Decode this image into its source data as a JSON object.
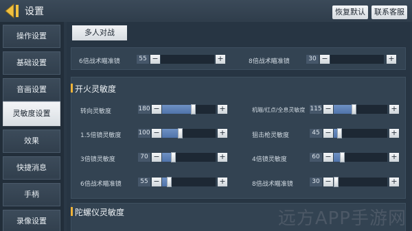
{
  "header": {
    "title": "设置",
    "restore_default": "恢复默认",
    "contact_service": "联系客服"
  },
  "sidebar": {
    "items": [
      {
        "label": "操作设置"
      },
      {
        "label": "基础设置"
      },
      {
        "label": "音画设置"
      },
      {
        "label": "灵敏度设置",
        "active": true
      },
      {
        "label": "效果"
      },
      {
        "label": "快捷消息"
      },
      {
        "label": "手柄"
      },
      {
        "label": "录像设置"
      }
    ]
  },
  "main": {
    "tab": "多人对战",
    "scopes": {
      "left": {
        "label": "6倍战术瞄准镜",
        "value": "55"
      },
      "right": {
        "label": "8倍战术瞄准镜",
        "value": "30"
      }
    },
    "fire_sensitivity": {
      "title": "开火灵敏度",
      "rows": [
        {
          "left": {
            "label": "转向灵敏度",
            "value": "180"
          },
          "right": {
            "label": "机瞄/红点/全息灵敏度",
            "value": "115"
          }
        },
        {
          "left": {
            "label": "1.5倍镜灵敏度",
            "value": "100"
          },
          "right": {
            "label": "狙击枪灵敏度",
            "value": "45"
          }
        },
        {
          "left": {
            "label": "3倍镜灵敏度",
            "value": "70"
          },
          "right": {
            "label": "4倍镜灵敏度",
            "value": "60"
          }
        },
        {
          "left": {
            "label": "6倍战术瞄准镜",
            "value": "55"
          },
          "right": {
            "label": "8倍战术瞄准镜",
            "value": "30"
          }
        }
      ]
    },
    "gyro_sensitivity": {
      "title": "陀螺仪灵敏度"
    }
  },
  "watermark": "远方APP手游网",
  "colors": {
    "accent": "#f0b43a",
    "slider_fill": "#5b7fb6"
  }
}
